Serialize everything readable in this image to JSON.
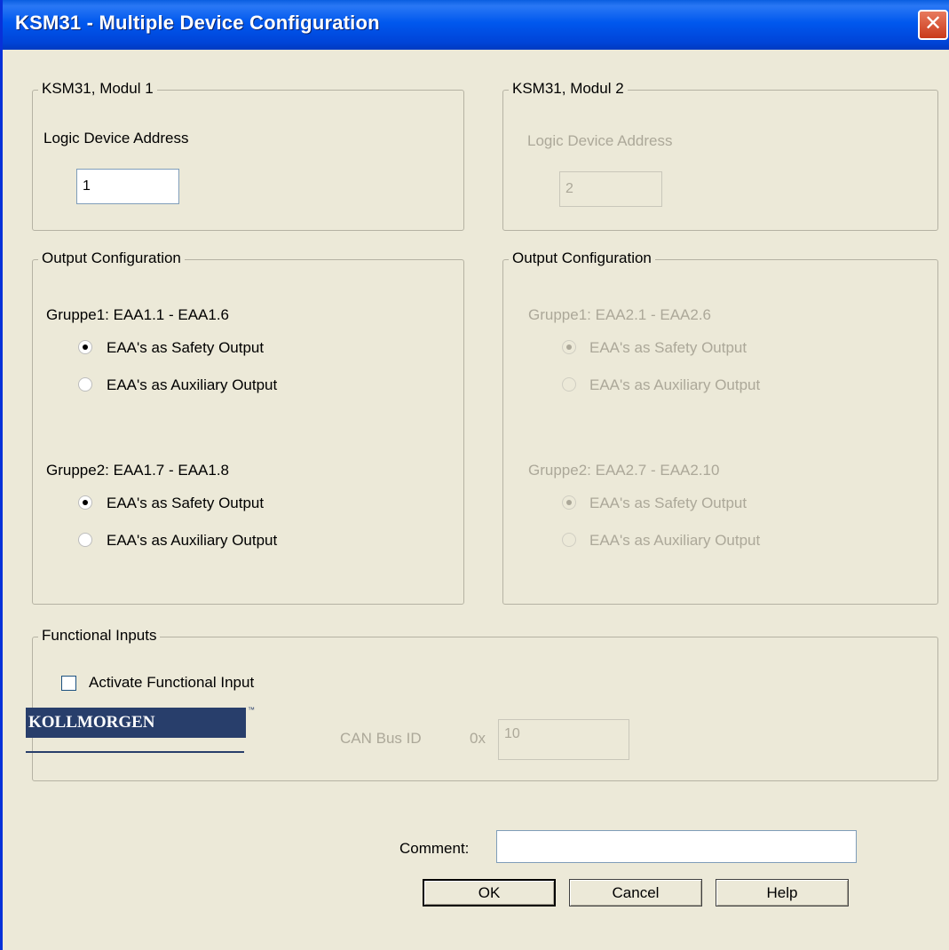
{
  "window": {
    "title": "KSM31 - Multiple Device Configuration",
    "close_glyph": "✕"
  },
  "module1": {
    "legend": "KSM31, Modul 1",
    "address_label": "Logic Device Address",
    "address_value": "1",
    "output": {
      "legend": "Output Configuration",
      "group1": {
        "label": "Gruppe1: EAA1.1 - EAA1.6",
        "opt_safety": "EAA's as Safety Output",
        "opt_aux": "EAA's as Auxiliary Output",
        "selected": "safety"
      },
      "group2": {
        "label": "Gruppe2: EAA1.7 - EAA1.8",
        "opt_safety": "EAA's as Safety Output",
        "opt_aux": "EAA's as Auxiliary Output",
        "selected": "safety"
      }
    }
  },
  "module2": {
    "legend": "KSM31, Modul 2",
    "address_label": "Logic Device Address",
    "address_value": "2",
    "output": {
      "legend": "Output Configuration",
      "group1": {
        "label": "Gruppe1: EAA2.1 - EAA2.6",
        "opt_safety": "EAA's as Safety Output",
        "opt_aux": "EAA's as Auxiliary Output",
        "selected": "safety"
      },
      "group2": {
        "label": "Gruppe2: EAA2.7 - EAA2.10",
        "opt_safety": "EAA's as Safety Output",
        "opt_aux": "EAA's as Auxiliary Output",
        "selected": "safety"
      }
    }
  },
  "functional": {
    "legend": "Functional Inputs",
    "checkbox_label": "Activate Functional Input",
    "checked": false,
    "canbus_label": "CAN Bus ID",
    "hex_prefix": "0x",
    "canbus_value": "10"
  },
  "footer": {
    "comment_label": "Comment:",
    "comment_value": "",
    "ok": "OK",
    "cancel": "Cancel",
    "help": "Help",
    "logo_text": "KOLLMORGEN",
    "logo_tm": "™"
  },
  "colors": {
    "titlebar": "#0058ee",
    "dialog_bg": "#ece9d8",
    "disabled_text": "#aca899",
    "logo_bg": "#283e6b"
  }
}
